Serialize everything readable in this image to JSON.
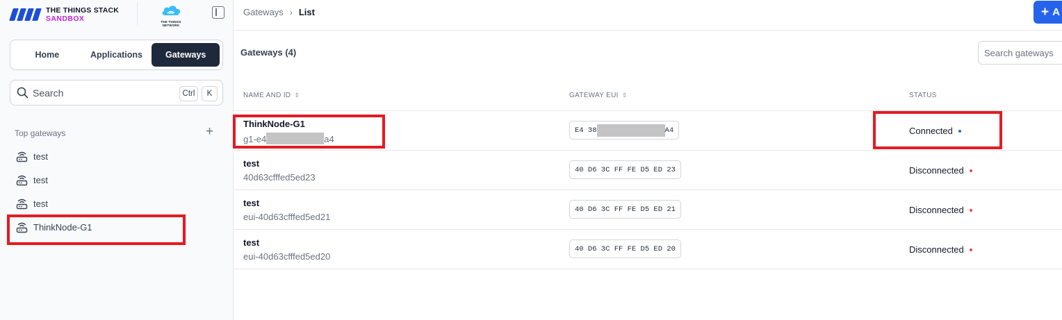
{
  "brand": {
    "line1": "THE THINGS STACK",
    "line2": "SANDBOX",
    "ttn_line1": "THE THINGS",
    "ttn_line2": "NETWORK"
  },
  "nav": {
    "tabs": [
      {
        "label": "Home"
      },
      {
        "label": "Applications"
      },
      {
        "label": "Gateways"
      }
    ],
    "active": "Gateways"
  },
  "sidebar_search": {
    "label": "Search",
    "kbd_ctrl": "Ctrl",
    "kbd_k": "K"
  },
  "top_gateways": {
    "label": "Top gateways",
    "add": "+",
    "items": [
      {
        "name": "test"
      },
      {
        "name": "test"
      },
      {
        "name": "test"
      },
      {
        "name": "ThinkNode-G1"
      }
    ]
  },
  "breadcrumb": {
    "parent": "Gateways",
    "sep": "›",
    "current": "List"
  },
  "add_button": {
    "plus": "+",
    "label": "A"
  },
  "list": {
    "title": "Gateways (4)",
    "search_placeholder": "Search gateways",
    "columns": {
      "name": "NAME AND ID",
      "eui": "GATEWAY EUI",
      "status": "STATUS",
      "sort": "⇕"
    },
    "rows": [
      {
        "name": "ThinkNode-G1",
        "id_prefix": "g1-e4",
        "id_suffix": "a4",
        "eui_prefix": "E4 38",
        "eui_suffix": "A4",
        "status": "Connected",
        "status_color": "#2563eb"
      },
      {
        "name": "test",
        "id": "40d63cfffed5ed23",
        "eui": "40 D6 3C FF FE D5 ED 23",
        "status": "Disconnected",
        "status_color": "#ef4444"
      },
      {
        "name": "test",
        "id": "eui-40d63cfffed5ed21",
        "eui": "40 D6 3C FF FE D5 ED 21",
        "status": "Disconnected",
        "status_color": "#ef4444"
      },
      {
        "name": "test",
        "id": "eui-40d63cfffed5ed20",
        "eui": "40 D6 3C FF FE D5 ED 20",
        "status": "Disconnected",
        "status_color": "#ef4444"
      }
    ]
  },
  "colors": {
    "accent": "#2563eb",
    "active_tab": "#1e293b",
    "annotation": "#e31b23",
    "brand_magenta": "#c026d3"
  }
}
